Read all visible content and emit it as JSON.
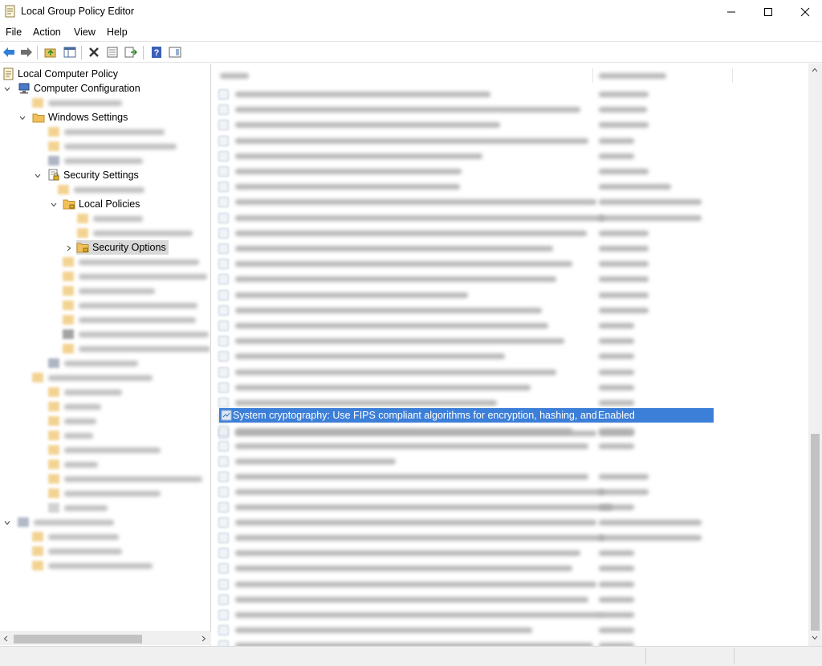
{
  "window": {
    "title": "Local Group Policy Editor",
    "controls": {
      "minimize": "—",
      "maximize": "☐",
      "close": "✕"
    }
  },
  "menu": [
    "File",
    "Action",
    "View",
    "Help"
  ],
  "toolbar": {
    "icons": [
      "back-icon",
      "forward-icon",
      "up-folder-icon",
      "show-hide-tree-icon",
      "delete-icon",
      "properties-icon",
      "export-list-icon",
      "help-icon",
      "action-pane-icon"
    ]
  },
  "tree": {
    "root": "Local Computer Policy",
    "computer_config": "Computer Configuration",
    "windows_settings": "Windows Settings",
    "security_settings": "Security Settings",
    "local_policies": "Local Policies",
    "security_options": "Security Options"
  },
  "list": {
    "selected_row": {
      "policy": "System cryptography: Use FIPS compliant algorithms for encryption, hashing, and ...",
      "setting": "Enabled"
    }
  },
  "colors": {
    "selection": "#3c7fd8",
    "tree_selection": "#d9d9d9",
    "folder": "#f0c05a"
  }
}
